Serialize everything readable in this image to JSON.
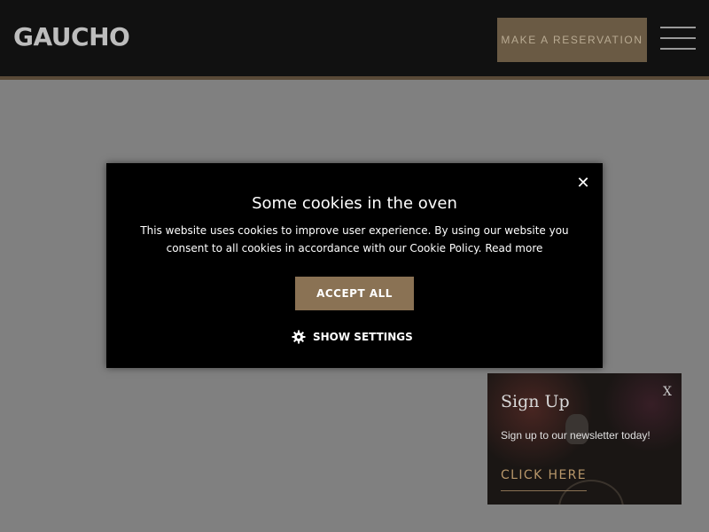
{
  "header": {
    "logo": "GAUCHO",
    "reservation_button": "MAKE A RESERVATION",
    "menu_icon": "hamburger-menu-icon"
  },
  "cookie_dialog": {
    "close_icon": "close-icon",
    "close_glyph": "✕",
    "title": "Some cookies in the oven",
    "body_text": "This website uses cookies to improve user experience. By using our website you consent to all cookies in accordance with our Cookie Policy.",
    "read_more": "Read more",
    "accept_button": "ACCEPT ALL",
    "settings_icon": "gear-icon",
    "settings_button": "SHOW SETTINGS"
  },
  "signup_popup": {
    "close_label": "X",
    "title": "Sign Up",
    "text": "Sign up to our newsletter today!",
    "link": "CLICK HERE"
  },
  "colors": {
    "header_bg": "#111111",
    "overlay_bg": "#808080",
    "accent": "#8a7254",
    "modal_bg": "#000000"
  }
}
